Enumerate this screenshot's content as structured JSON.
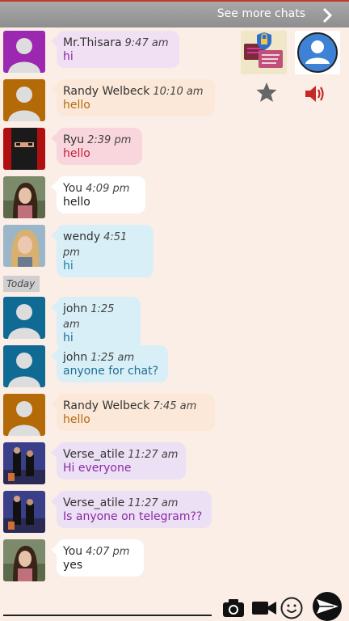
{
  "topbar": {
    "see_more": "See more chats"
  },
  "date_separator": "Today",
  "messages": [
    {
      "name": "Mr.Thisara",
      "time": "9:47 am",
      "text": "hi",
      "bubble": "#f1e0f4",
      "textColor": "#8c2aa0",
      "avatar": "default-purple"
    },
    {
      "name": "Randy Welbeck",
      "time": "10:10 am",
      "text": "hello",
      "bubble": "#fbe8d8",
      "textColor": "#b06a10",
      "avatar": "default-orange"
    },
    {
      "name": "Ryu",
      "time": "2:39 pm",
      "text": "hello",
      "bubble": "#f9d6dd",
      "textColor": "#c61e3c",
      "avatar": "photo-ryu"
    },
    {
      "name": "You",
      "time": "4:09 pm",
      "text": "hello",
      "bubble": "#ffffff",
      "textColor": "#222222",
      "avatar": "photo-you"
    },
    {
      "name": "wendy",
      "time": "4:51 pm",
      "text": "hi",
      "bubble": "#d8eff7",
      "textColor": "#1f7aa6",
      "avatar": "photo-wendy"
    },
    {
      "name": "john",
      "time": "1:25 am",
      "text": "hi",
      "bubble": "#d8eff7",
      "textColor": "#1f6e92",
      "avatar": "default-blue"
    },
    {
      "name": "john",
      "time": "1:25 am",
      "text": "anyone for chat?",
      "bubble": "#d8eff7",
      "textColor": "#1f6e92",
      "avatar": "default-blue"
    },
    {
      "name": "Randy Welbeck",
      "time": "7:45 am",
      "text": "hello",
      "bubble": "#fbe8d8",
      "textColor": "#b06a10",
      "avatar": "default-orange"
    },
    {
      "name": "Verse_atile",
      "time": "11:27 am",
      "text": "Hi everyone",
      "bubble": "#ece0f4",
      "textColor": "#8a2aa6",
      "avatar": "photo-verse"
    },
    {
      "name": "Verse_atile",
      "time": "11:27 am",
      "text": "Is anyone on telegram??",
      "bubble": "#ece0f4",
      "textColor": "#8a2aa6",
      "avatar": "photo-verse"
    },
    {
      "name": "You",
      "time": "4:07 pm",
      "text": "yes",
      "bubble": "#ffffff",
      "textColor": "#222222",
      "avatar": "photo-you"
    }
  ],
  "icons": {
    "chat_lock": "chat-lock-icon",
    "profile": "profile-icon",
    "star": "star-icon",
    "speaker": "speaker-icon",
    "camera": "camera-icon",
    "video": "video-icon",
    "emoji": "emoji-icon",
    "send": "send-icon"
  }
}
